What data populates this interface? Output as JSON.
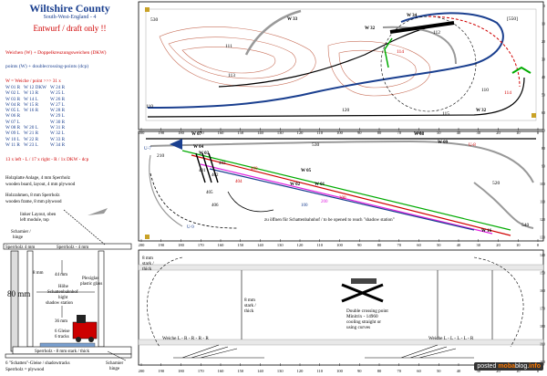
{
  "header": {
    "title": "Wiltshire County",
    "subtitle": "South-West-England - 4",
    "draft": "Entwurf / draft only !!"
  },
  "legend": {
    "line1": "Weichen (W) + Doppelkreuzungsweichen (DKW)",
    "line2": "points (W) + doublecrossing-points (dcp)",
    "turnout_header": "W = Weiche / point   >>>   31 x",
    "turnouts": [
      [
        "W 01 R",
        "W 12 DKW",
        "W 24 R"
      ],
      [
        "W 02 L",
        "W 13 R",
        "W 25 L"
      ],
      [
        "W 03 R",
        "W 14 L",
        "W 26 R"
      ],
      [
        "W 04 R",
        "W 15 R",
        "W 27 L"
      ],
      [
        "W 05 L",
        "W 16 R",
        "W 28 R"
      ],
      [
        "W 06 R",
        "",
        "W 29 L"
      ],
      [
        "W 07 L",
        "",
        "W 30 R"
      ],
      [
        "W 08 R",
        "W 20 L",
        "W 31 R"
      ],
      [
        "W 09 L",
        "W 21 R",
        "W 32 L"
      ],
      [
        "W 10 L",
        "W 22 R",
        "W 33 R"
      ],
      [
        "W 11 R",
        "W 23 L",
        "W 34 R"
      ]
    ],
    "summary": "13 x left - L  /  17 x right - R  /  1x DKW - dcp"
  },
  "notes": {
    "holz": "Holzplatte Anlage, 4 mm Sperrholz",
    "holz_en": "wooden board, layout, 4 mm plywood",
    "rahmen": "Holzrahmen, 8 mm Sperrholz",
    "rahmen_en": "wooden frame, 8 mm plywood",
    "links": "linker Layout, oben",
    "links_en": "left module, top",
    "schanier": "Scharnier /",
    "schanier_en": "hinge",
    "sperrholz_top": "Sperrholz - 4 mm",
    "sperrholz_left": "Sperrholz 4 mm",
    "mm44": "44 mm",
    "hoehe": "Höhe",
    "schatten": "Schattenbahnhof",
    "hight": "hight",
    "shadow": "shadow station",
    "plexi": "Plexiglas",
    "plexi_en": "plastic glass",
    "mm80": "80 mm",
    "mm8": "8 mm",
    "mm36": "36 mm",
    "gleise": "6 Gleise",
    "tracks": "6 tracks",
    "sperrholz_bottom": "Sperrholz - 8 mm stark / thick",
    "schatten_gleise": "6 \"Schatten\"-Gleise / shadowtracks",
    "sperrholz_ply": "Sperrholz = plywood",
    "schanier2": "Scharnier",
    "hinge2": "hinge"
  },
  "diagram": {
    "ruler_top": [
      "200",
      "190",
      "180",
      "170",
      "160",
      "150",
      "140",
      "130",
      "120",
      "110",
      "100",
      "90",
      "80",
      "70",
      "60",
      "50",
      "40",
      "30",
      "20",
      "10",
      "0"
    ],
    "ruler_side": [
      "0",
      "10",
      "20",
      "30",
      "40",
      "50",
      "60",
      "70",
      "80",
      "90",
      "100",
      "110",
      "120",
      "130",
      "140",
      "150",
      "160",
      "170",
      "180",
      "190",
      "200"
    ],
    "level_labels": [
      "530",
      "111",
      "113",
      "110",
      "112",
      "114",
      "120",
      "115",
      "110",
      "114",
      "[550]",
      "530",
      "210",
      "410",
      "520",
      "540",
      "110",
      "310",
      "210",
      "520",
      "560"
    ],
    "turnout_labels": [
      "W 33",
      "W 34",
      "W 31",
      "W 30",
      "W 32",
      "W 08",
      "W 07",
      "W 09",
      "W 06",
      "W 04",
      "W 03",
      "W 05",
      "W 02",
      "W 01",
      "W 10",
      "W 11",
      "W 12",
      "W 13",
      "W 14",
      "W 15",
      "W 16",
      "W 17"
    ],
    "track_numbers": [
      "401",
      "402",
      "403",
      "404",
      "405",
      "406",
      "400",
      "11",
      "12",
      "300",
      "200",
      "100",
      "U-7",
      "U-8",
      "U-9"
    ],
    "center_note": "zu öffnen für Schattenbahnhof  /  to be opened to reach \"shadow station\"",
    "dcp_note": "Double crossing point",
    "dcp_note2": "Minitrix - 14960",
    "dcp_note3": "cooling straight  or",
    "dcp_note4": "using curves",
    "weiche_left": "Weiche L - R - R - R - R",
    "weiche_right": "Weiche L - L - L - L - R",
    "thick8": "8 mm",
    "thick8b": "stark /",
    "thick8c": "thick",
    "thick8_tl": "8 mm",
    "thick8_tl2": "stark /",
    "thick8_tl3": "thick"
  },
  "watermark": {
    "pre": "posted",
    "brand": "moba",
    "suffix": "blog.",
    "tld": "info"
  }
}
